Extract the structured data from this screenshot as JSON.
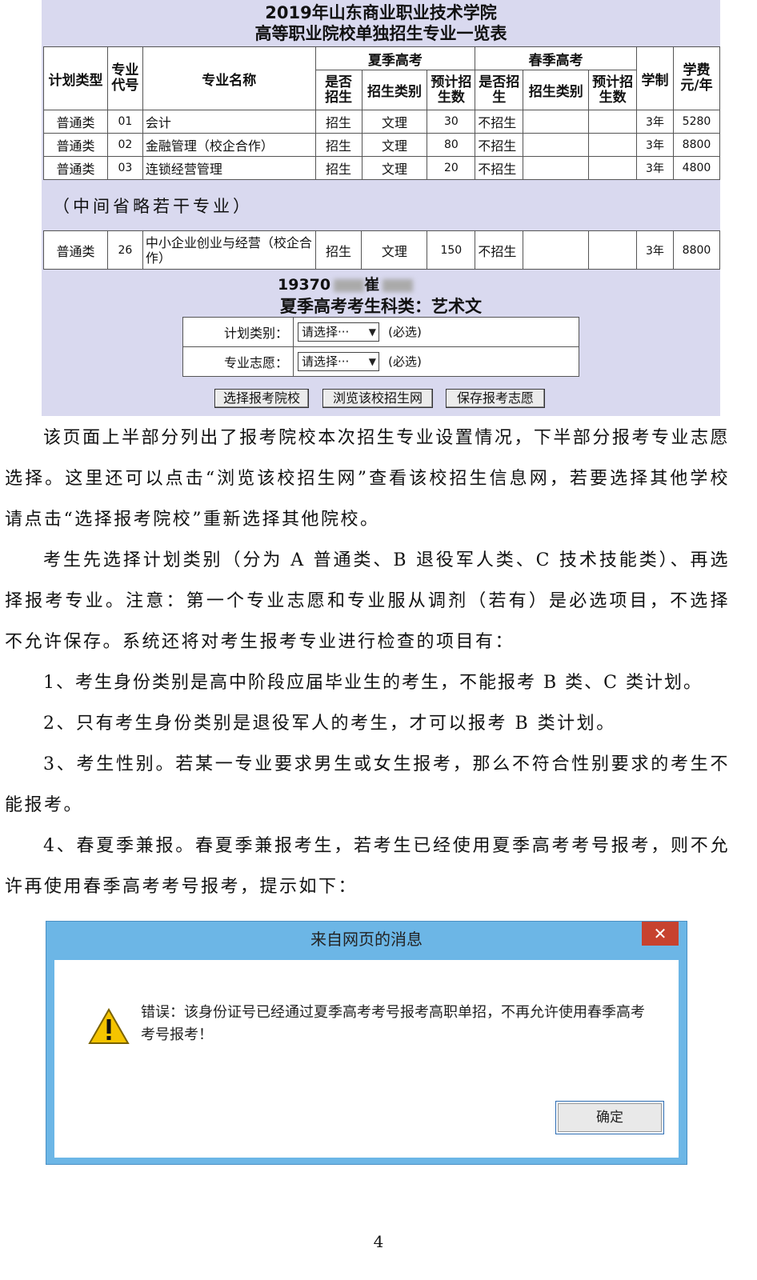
{
  "header": {
    "title_line1": "2019年山东商业职业技术学院",
    "title_line2": "高等职业院校单独招生专业一览表"
  },
  "table": {
    "col_plan_type": "计划类型",
    "col_code": "专业代号",
    "col_name": "专业名称",
    "group_summer": "夏季高考",
    "group_spring": "春季高考",
    "col_enroll": "是否招生",
    "col_category": "招生类别",
    "col_count": "预计招生数",
    "col_years": "学制",
    "col_fee": "学费元/年",
    "rows": [
      [
        "普通类",
        "01",
        "会计",
        "招生",
        "文理",
        "30",
        "不招生",
        "",
        "",
        "3年",
        "5280"
      ],
      [
        "普通类",
        "02",
        "金融管理（校企合作）",
        "招生",
        "文理",
        "80",
        "不招生",
        "",
        "",
        "3年",
        "8800"
      ],
      [
        "普通类",
        "03",
        "连锁经营管理",
        "招生",
        "文理",
        "20",
        "不招生",
        "",
        "",
        "3年",
        "4800"
      ]
    ],
    "omitted_note": "（中间省略若干专业）",
    "last_row": [
      "普通类",
      "26",
      "中小企业创业与经营（校企合作）",
      "招生",
      "文理",
      "150",
      "不招生",
      "",
      "",
      "3年",
      "8800"
    ]
  },
  "form": {
    "id_line": "19370",
    "id_line_tail": "崔",
    "subject": "夏季高考考生科类：艺术文",
    "plan_label": "计划类别：",
    "plan_value": "请选择···",
    "major_label": "专业志愿：",
    "major_value": "请选择···",
    "required": "(必选)",
    "btn_select_school": "选择报考院校",
    "btn_browse_site": "浏览该校招生网",
    "btn_save": "保存报考志愿"
  },
  "body": {
    "p1": "该页面上半部分列出了报考院校本次招生专业设置情况，下半部分报考专业志愿选择。这里还可以点击“浏览该校招生网”查看该校招生信息网，若要选择其他学校请点击“选择报考院校”重新选择其他院校。",
    "p2": "考生先选择计划类别（分为 A 普通类、B 退役军人类、C 技术技能类）、再选择报考专业。注意：第一个专业志愿和专业服从调剂（若有）是必选项目，不选择不允许保存。系统还将对考生报考专业进行检查的项目有：",
    "p3": "1、考生身份类别是高中阶段应届毕业生的考生，不能报考 B 类、C 类计划。",
    "p4": "2、只有考生身份类别是退役军人的考生，才可以报考 B 类计划。",
    "p5": "3、考生性别。若某一专业要求男生或女生报考，那么不符合性别要求的考生不能报考。",
    "p6": "4、春夏季兼报。春夏季兼报考生，若考生已经使用夏季高考考号报考，则不允许再使用春季高考考号报考，提示如下："
  },
  "dialog": {
    "title": "来自网页的消息",
    "close": "✕",
    "message": "错误：该身份证号已经通过夏季高考考号报考高职单招，不再允许使用春季高考考号报考！",
    "ok": "确定"
  },
  "page_number": "4"
}
